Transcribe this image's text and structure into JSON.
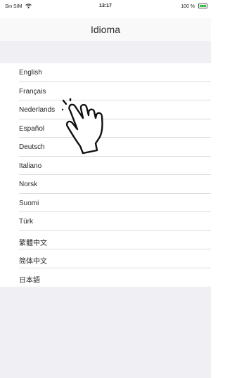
{
  "status_bar": {
    "carrier": "Sin SIM",
    "time": "13:17",
    "battery": "100 %",
    "battery_color": "#3cc24a"
  },
  "header": {
    "title": "Idioma"
  },
  "languages": [
    {
      "label": "English"
    },
    {
      "label": "Français"
    },
    {
      "label": "Nederlands"
    },
    {
      "label": "Español"
    },
    {
      "label": "Deutsch"
    },
    {
      "label": "Italiano"
    },
    {
      "label": "Norsk"
    },
    {
      "label": "Suomi"
    },
    {
      "label": "Türk"
    },
    {
      "label": "繁體中文"
    },
    {
      "label": "简体中文"
    },
    {
      "label": "日本語"
    }
  ],
  "icons": {
    "wifi": "wifi-icon",
    "battery": "battery-icon",
    "pointer": "hand-pointer-icon"
  }
}
